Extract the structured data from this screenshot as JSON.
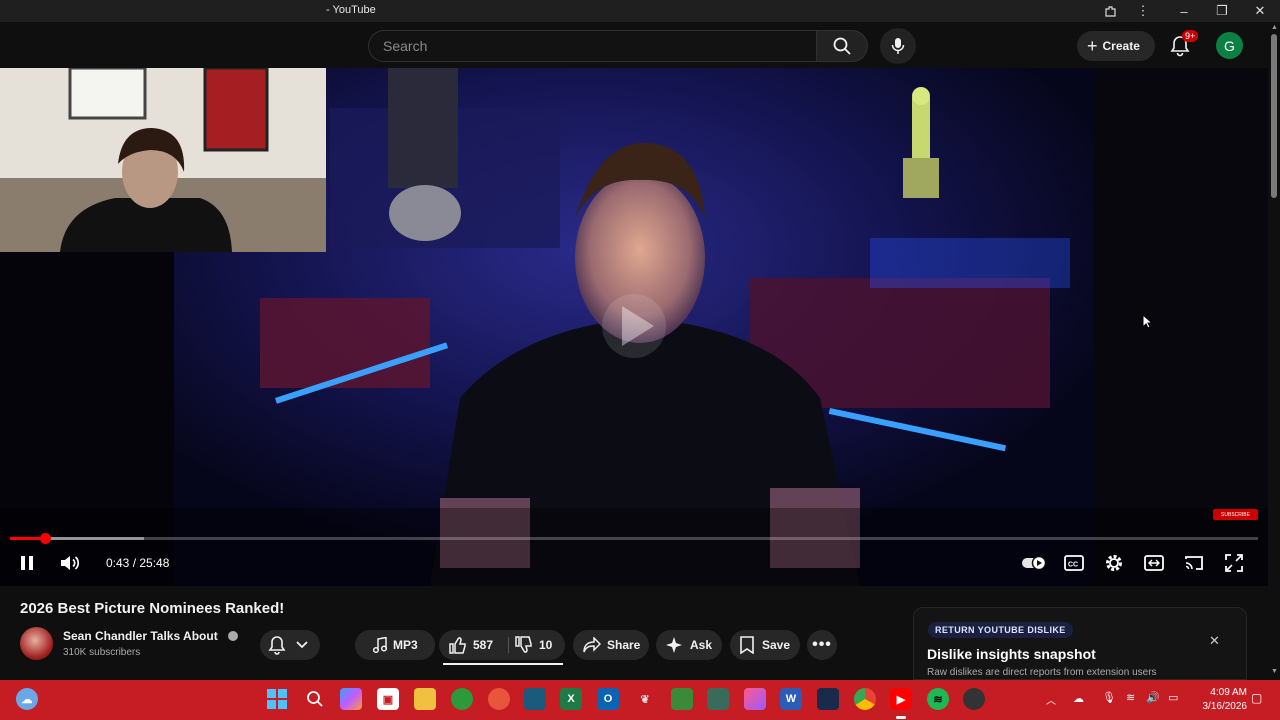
{
  "window": {
    "title": "- YouTube"
  },
  "header": {
    "search_placeholder": "Search",
    "create_label": "Create",
    "notification_count": "9+",
    "avatar_letter": "G"
  },
  "player": {
    "time": "0:43 / 25:48",
    "progress_fraction": 0.028,
    "buffer_fraction": 0.107,
    "state": "playing",
    "watermark": "SUBSCRIBE"
  },
  "video": {
    "title": "2026 Best Picture Nominees Ranked!",
    "channel_name": "Sean Chandler Talks About",
    "subscribers": "310K subscribers"
  },
  "actions": {
    "mp3_label": "MP3",
    "like_count": "587",
    "dislike_count": "10",
    "share_label": "Share",
    "ask_label": "Ask",
    "save_label": "Save"
  },
  "dislike_panel": {
    "badge": "RETURN YOUTUBE DISLIKE",
    "title": "Dislike insights snapshot",
    "subtitle": "Raw dislikes are direct reports from extension users"
  },
  "taskbar": {
    "time": "4:09 AM",
    "date": "3/16/2026"
  },
  "colors": {
    "accent_red": "#ff0000",
    "taskbar": "#c51d23",
    "background": "#0f0f0f"
  }
}
